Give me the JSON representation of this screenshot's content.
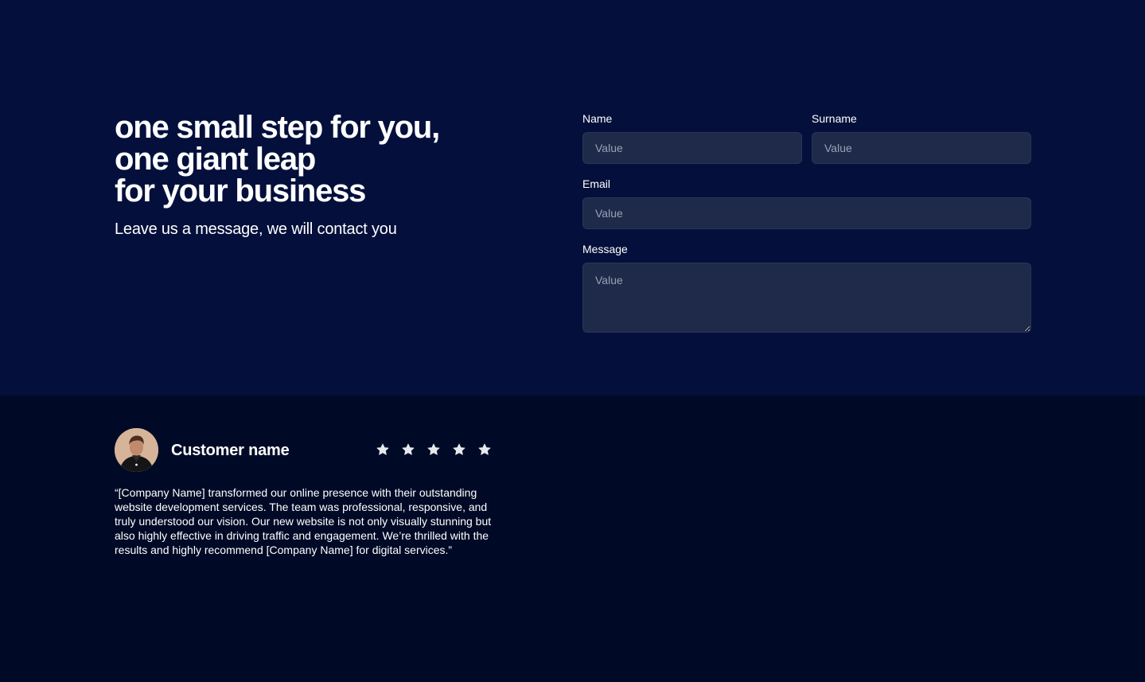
{
  "hero": {
    "headline_lines": [
      "one small step for you,",
      "one giant leap",
      "for your business"
    ],
    "subhead": "Leave us a message, we will contact you"
  },
  "form": {
    "name": {
      "label": "Name",
      "placeholder": "Value"
    },
    "surname": {
      "label": "Surname",
      "placeholder": "Value"
    },
    "email": {
      "label": "Email",
      "placeholder": "Value"
    },
    "message": {
      "label": "Message",
      "placeholder": "Value"
    }
  },
  "testimonial": {
    "customer_name": "Customer name",
    "rating": 5,
    "rating_max": 5,
    "quote": "“[Company Name] transformed our online presence with their outstanding website development services. The team was professional, responsive, and truly understood our vision. Our new website is not only visually stunning but also highly effective in driving traffic and engagement. We’re thrilled with the results and highly recommend [Company Name] for digital services.”",
    "avatar_icon": "person-avatar",
    "star_icon": "star-icon"
  },
  "colors": {
    "hero_background": "#04103b",
    "page_background": "#000a26",
    "input_background": "#1f2949",
    "text": "#ffffff",
    "star": "#e6e8ef"
  }
}
